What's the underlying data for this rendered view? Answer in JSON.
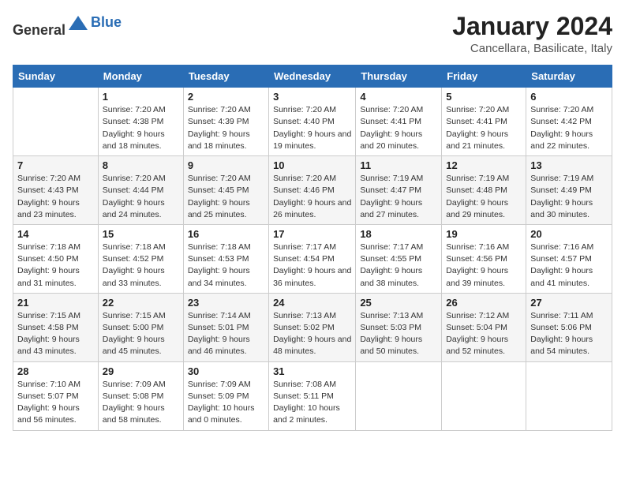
{
  "header": {
    "logo_general": "General",
    "logo_blue": "Blue",
    "month": "January 2024",
    "location": "Cancellara, Basilicate, Italy"
  },
  "weekdays": [
    "Sunday",
    "Monday",
    "Tuesday",
    "Wednesday",
    "Thursday",
    "Friday",
    "Saturday"
  ],
  "weeks": [
    [
      {
        "day": "",
        "sunrise": "",
        "sunset": "",
        "daylight": ""
      },
      {
        "day": "1",
        "sunrise": "Sunrise: 7:20 AM",
        "sunset": "Sunset: 4:38 PM",
        "daylight": "Daylight: 9 hours and 18 minutes."
      },
      {
        "day": "2",
        "sunrise": "Sunrise: 7:20 AM",
        "sunset": "Sunset: 4:39 PM",
        "daylight": "Daylight: 9 hours and 18 minutes."
      },
      {
        "day": "3",
        "sunrise": "Sunrise: 7:20 AM",
        "sunset": "Sunset: 4:40 PM",
        "daylight": "Daylight: 9 hours and 19 minutes."
      },
      {
        "day": "4",
        "sunrise": "Sunrise: 7:20 AM",
        "sunset": "Sunset: 4:41 PM",
        "daylight": "Daylight: 9 hours and 20 minutes."
      },
      {
        "day": "5",
        "sunrise": "Sunrise: 7:20 AM",
        "sunset": "Sunset: 4:41 PM",
        "daylight": "Daylight: 9 hours and 21 minutes."
      },
      {
        "day": "6",
        "sunrise": "Sunrise: 7:20 AM",
        "sunset": "Sunset: 4:42 PM",
        "daylight": "Daylight: 9 hours and 22 minutes."
      }
    ],
    [
      {
        "day": "7",
        "sunrise": "Sunrise: 7:20 AM",
        "sunset": "Sunset: 4:43 PM",
        "daylight": "Daylight: 9 hours and 23 minutes."
      },
      {
        "day": "8",
        "sunrise": "Sunrise: 7:20 AM",
        "sunset": "Sunset: 4:44 PM",
        "daylight": "Daylight: 9 hours and 24 minutes."
      },
      {
        "day": "9",
        "sunrise": "Sunrise: 7:20 AM",
        "sunset": "Sunset: 4:45 PM",
        "daylight": "Daylight: 9 hours and 25 minutes."
      },
      {
        "day": "10",
        "sunrise": "Sunrise: 7:20 AM",
        "sunset": "Sunset: 4:46 PM",
        "daylight": "Daylight: 9 hours and 26 minutes."
      },
      {
        "day": "11",
        "sunrise": "Sunrise: 7:19 AM",
        "sunset": "Sunset: 4:47 PM",
        "daylight": "Daylight: 9 hours and 27 minutes."
      },
      {
        "day": "12",
        "sunrise": "Sunrise: 7:19 AM",
        "sunset": "Sunset: 4:48 PM",
        "daylight": "Daylight: 9 hours and 29 minutes."
      },
      {
        "day": "13",
        "sunrise": "Sunrise: 7:19 AM",
        "sunset": "Sunset: 4:49 PM",
        "daylight": "Daylight: 9 hours and 30 minutes."
      }
    ],
    [
      {
        "day": "14",
        "sunrise": "Sunrise: 7:18 AM",
        "sunset": "Sunset: 4:50 PM",
        "daylight": "Daylight: 9 hours and 31 minutes."
      },
      {
        "day": "15",
        "sunrise": "Sunrise: 7:18 AM",
        "sunset": "Sunset: 4:52 PM",
        "daylight": "Daylight: 9 hours and 33 minutes."
      },
      {
        "day": "16",
        "sunrise": "Sunrise: 7:18 AM",
        "sunset": "Sunset: 4:53 PM",
        "daylight": "Daylight: 9 hours and 34 minutes."
      },
      {
        "day": "17",
        "sunrise": "Sunrise: 7:17 AM",
        "sunset": "Sunset: 4:54 PM",
        "daylight": "Daylight: 9 hours and 36 minutes."
      },
      {
        "day": "18",
        "sunrise": "Sunrise: 7:17 AM",
        "sunset": "Sunset: 4:55 PM",
        "daylight": "Daylight: 9 hours and 38 minutes."
      },
      {
        "day": "19",
        "sunrise": "Sunrise: 7:16 AM",
        "sunset": "Sunset: 4:56 PM",
        "daylight": "Daylight: 9 hours and 39 minutes."
      },
      {
        "day": "20",
        "sunrise": "Sunrise: 7:16 AM",
        "sunset": "Sunset: 4:57 PM",
        "daylight": "Daylight: 9 hours and 41 minutes."
      }
    ],
    [
      {
        "day": "21",
        "sunrise": "Sunrise: 7:15 AM",
        "sunset": "Sunset: 4:58 PM",
        "daylight": "Daylight: 9 hours and 43 minutes."
      },
      {
        "day": "22",
        "sunrise": "Sunrise: 7:15 AM",
        "sunset": "Sunset: 5:00 PM",
        "daylight": "Daylight: 9 hours and 45 minutes."
      },
      {
        "day": "23",
        "sunrise": "Sunrise: 7:14 AM",
        "sunset": "Sunset: 5:01 PM",
        "daylight": "Daylight: 9 hours and 46 minutes."
      },
      {
        "day": "24",
        "sunrise": "Sunrise: 7:13 AM",
        "sunset": "Sunset: 5:02 PM",
        "daylight": "Daylight: 9 hours and 48 minutes."
      },
      {
        "day": "25",
        "sunrise": "Sunrise: 7:13 AM",
        "sunset": "Sunset: 5:03 PM",
        "daylight": "Daylight: 9 hours and 50 minutes."
      },
      {
        "day": "26",
        "sunrise": "Sunrise: 7:12 AM",
        "sunset": "Sunset: 5:04 PM",
        "daylight": "Daylight: 9 hours and 52 minutes."
      },
      {
        "day": "27",
        "sunrise": "Sunrise: 7:11 AM",
        "sunset": "Sunset: 5:06 PM",
        "daylight": "Daylight: 9 hours and 54 minutes."
      }
    ],
    [
      {
        "day": "28",
        "sunrise": "Sunrise: 7:10 AM",
        "sunset": "Sunset: 5:07 PM",
        "daylight": "Daylight: 9 hours and 56 minutes."
      },
      {
        "day": "29",
        "sunrise": "Sunrise: 7:09 AM",
        "sunset": "Sunset: 5:08 PM",
        "daylight": "Daylight: 9 hours and 58 minutes."
      },
      {
        "day": "30",
        "sunrise": "Sunrise: 7:09 AM",
        "sunset": "Sunset: 5:09 PM",
        "daylight": "Daylight: 10 hours and 0 minutes."
      },
      {
        "day": "31",
        "sunrise": "Sunrise: 7:08 AM",
        "sunset": "Sunset: 5:11 PM",
        "daylight": "Daylight: 10 hours and 2 minutes."
      },
      {
        "day": "",
        "sunrise": "",
        "sunset": "",
        "daylight": ""
      },
      {
        "day": "",
        "sunrise": "",
        "sunset": "",
        "daylight": ""
      },
      {
        "day": "",
        "sunrise": "",
        "sunset": "",
        "daylight": ""
      }
    ]
  ]
}
